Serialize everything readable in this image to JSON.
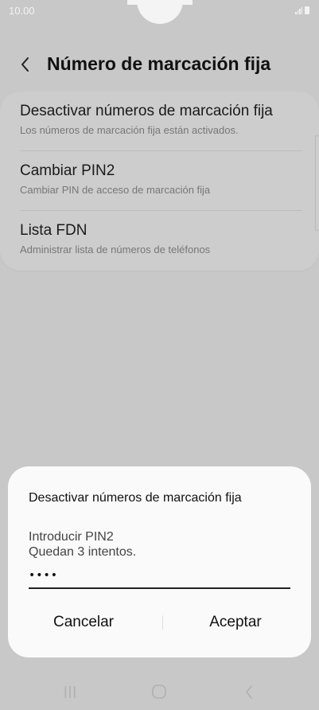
{
  "status_bar": {
    "time": "10.00"
  },
  "header": {
    "title": "Número de marcación fija",
    "back_icon": "chevron-left-icon"
  },
  "settings": {
    "items": [
      {
        "title": "Desactivar números de marcación fija",
        "subtitle": "Los números de marcación fija están activados."
      },
      {
        "title": "Cambiar PIN2",
        "subtitle": "Cambiar PIN de acceso de marcación fija"
      },
      {
        "title": "Lista FDN",
        "subtitle": "Administrar lista de números de teléfonos"
      }
    ]
  },
  "dialog": {
    "title": "Desactivar números de marcación fija",
    "prompt": "Introducir PIN2",
    "attempts": "Quedan 3 intentos.",
    "pin_value": "••••",
    "cancel_label": "Cancelar",
    "accept_label": "Aceptar"
  },
  "nav_bar": {
    "icons": [
      "recent-apps-icon",
      "home-icon",
      "back-icon"
    ]
  },
  "colors": {
    "background_dim": "#c8c8c8",
    "dialog_background": "#fafafa",
    "status_text": "#f2f2f2"
  }
}
